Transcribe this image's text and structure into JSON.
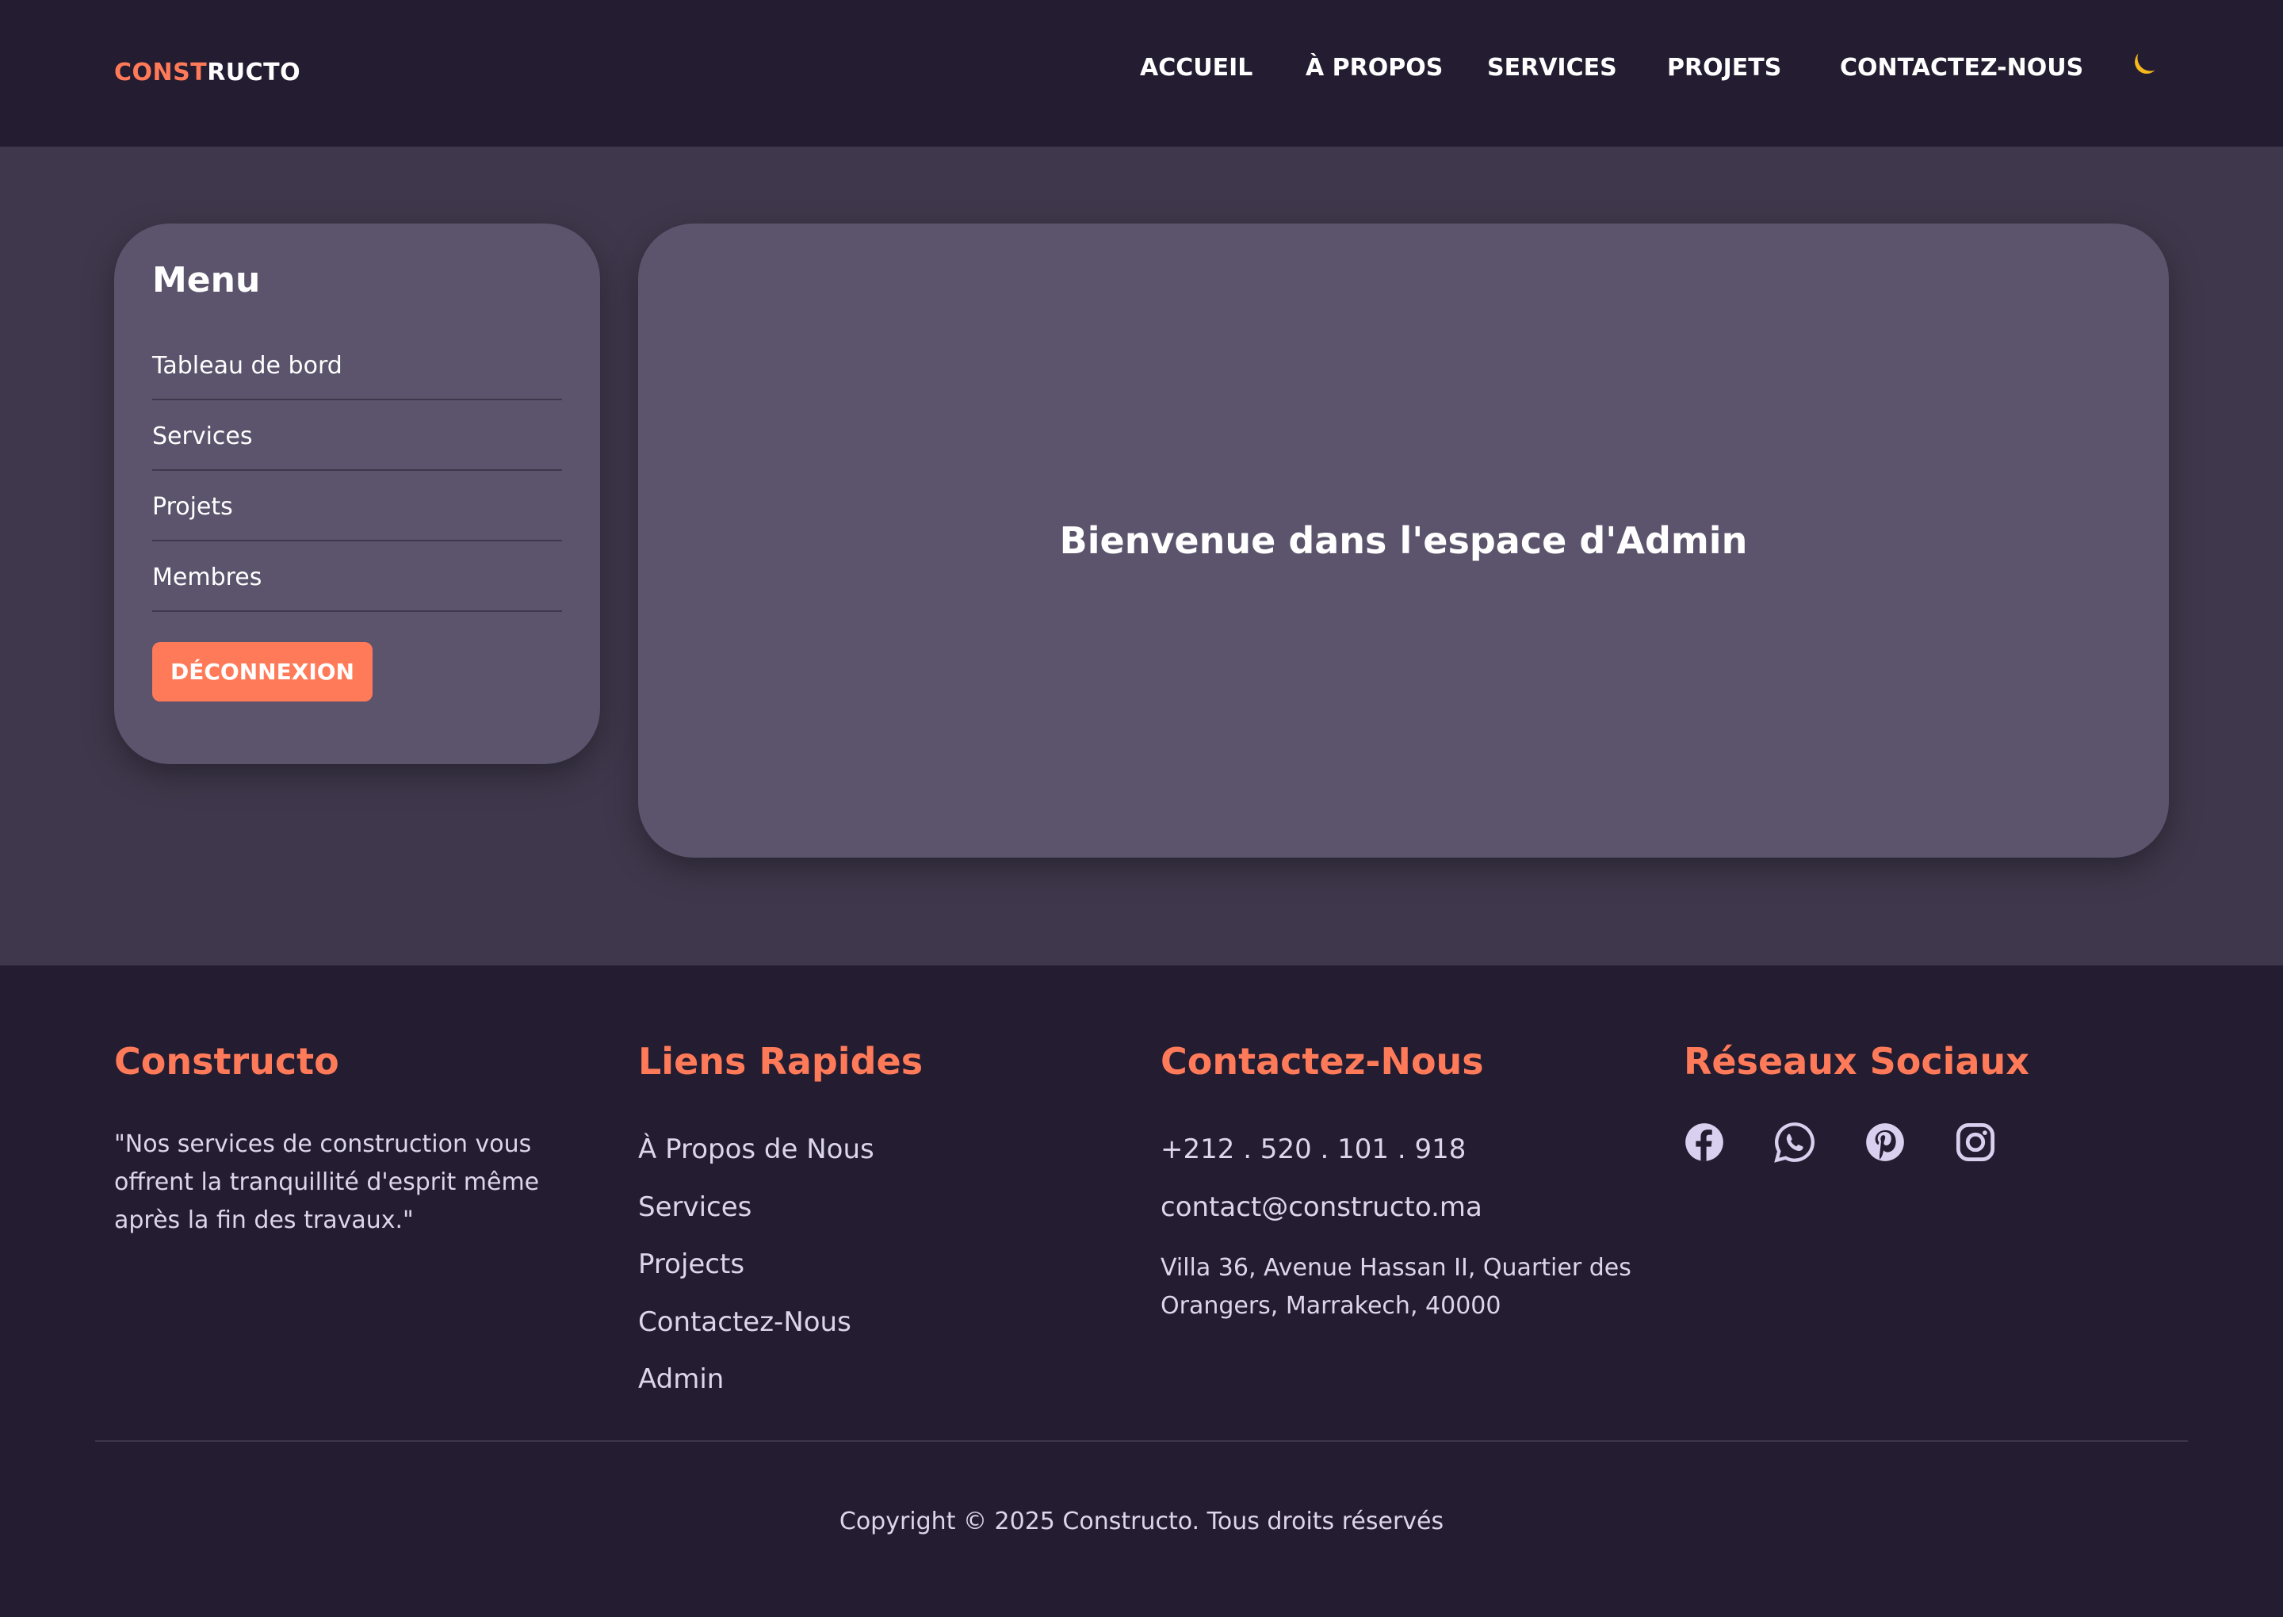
{
  "header": {
    "logo_accent": "CONST",
    "logo_rest": "RUCTO",
    "nav": [
      "ACCUEIL",
      "À PROPOS",
      "SERVICES",
      "PROJETS",
      "CONTACTEZ-NOUS"
    ],
    "theme_icon": "moon-icon"
  },
  "sidebar": {
    "title": "Menu",
    "items": [
      "Tableau de bord",
      "Services",
      "Projets",
      "Membres"
    ],
    "logout_label": "DÉCONNEXION"
  },
  "main": {
    "welcome": "Bienvenue dans l'espace d'Admin"
  },
  "footer": {
    "brand_heading": "Constructo",
    "quote": "\"Nos services de construction vous offrent la tranquillité d'esprit même après la fin des travaux.\"",
    "links_heading": "Liens Rapides",
    "links": [
      "À Propos de Nous",
      "Services",
      "Projects",
      "Contactez-Nous",
      "Admin"
    ],
    "contact_heading": "Contactez-Nous",
    "phone": "+212 . 520 . 101 . 918",
    "email": "contact@constructo.ma",
    "address": "Villa 36, Avenue Hassan II, Quartier des Orangers, Marrakech, 40000",
    "social_heading": "Réseaux Sociaux",
    "social_icons": [
      "facebook-icon",
      "whatsapp-icon",
      "pinterest-icon",
      "instagram-icon"
    ],
    "copyright": "Copyright © 2025 Constructo. Tous droits réservés"
  },
  "colors": {
    "accent": "#ff7a59",
    "dark_bg": "#241c30",
    "main_bg": "#3f384c",
    "card_bg": "#5b546c",
    "moon": "#f5b81c"
  }
}
